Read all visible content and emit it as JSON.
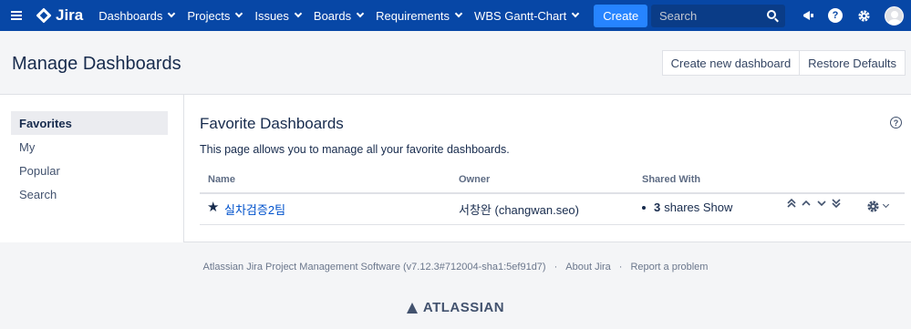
{
  "nav": {
    "brand": "Jira",
    "items": [
      {
        "label": "Dashboards"
      },
      {
        "label": "Projects"
      },
      {
        "label": "Issues"
      },
      {
        "label": "Boards"
      },
      {
        "label": "Requirements"
      },
      {
        "label": "WBS Gantt-Chart"
      }
    ],
    "create_label": "Create",
    "search_placeholder": "Search",
    "icons": [
      "notifications-icon",
      "help-icon",
      "settings-icon",
      "avatar"
    ]
  },
  "header": {
    "title": "Manage Dashboards",
    "create_label": "Create new dashboard",
    "restore_label": "Restore Defaults"
  },
  "sidebar": {
    "items": [
      {
        "label": "Favorites",
        "active": true
      },
      {
        "label": "My"
      },
      {
        "label": "Popular"
      },
      {
        "label": "Search"
      }
    ]
  },
  "main": {
    "title": "Favorite Dashboards",
    "description": "This page allows you to manage all your favorite dashboards.",
    "columns": {
      "name": "Name",
      "owner": "Owner",
      "shared": "Shared With"
    },
    "rows": [
      {
        "name": "실차검증2팀",
        "owner": "서창완 (changwan.seo)",
        "shares_count": "3",
        "shares_text": "shares Show"
      }
    ]
  },
  "footer": {
    "software": "Atlassian Jira Project Management Software (v7.12.3#712004-sha1:5ef91d7)",
    "about": "About Jira",
    "report": "Report a problem",
    "brand": "ATLASSIAN"
  },
  "colors": {
    "nav_bg": "#0747a6",
    "create_btn": "#2684ff",
    "link": "#0052cc"
  }
}
